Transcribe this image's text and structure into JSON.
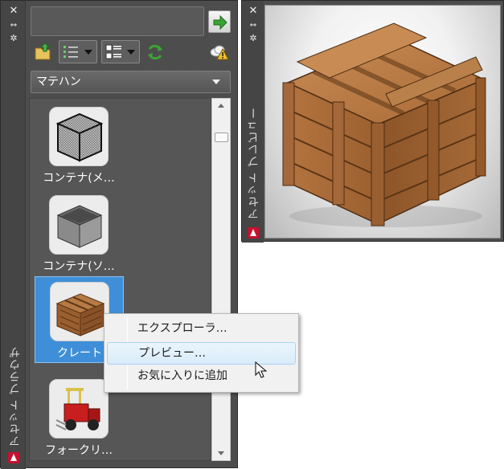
{
  "browser": {
    "title": "アセット ブラウザ",
    "search": {
      "value": "",
      "placeholder": ""
    },
    "category": {
      "selected": "マテハン"
    },
    "items": [
      {
        "label": "コンテナ(メ…",
        "icon": "wire-mesh-container-icon",
        "selected": false
      },
      {
        "label": "コンテナ(ソ…",
        "icon": "solid-container-icon",
        "selected": false
      },
      {
        "label": "クレート",
        "icon": "crate-icon",
        "selected": true
      },
      {
        "label": "フォークリ…",
        "icon": "forklift-icon",
        "selected": false
      }
    ]
  },
  "context_menu": {
    "items": [
      {
        "label": "エクスプローラ…"
      },
      {
        "label": "プレビュー…",
        "hovered": true
      },
      {
        "label": "お気に入りに追加"
      }
    ]
  },
  "preview": {
    "title": "アセット プレビュー",
    "subject_icon": "wooden-crate-icon"
  },
  "colors": {
    "panel_bg": "#4d4d4d",
    "selection": "#3f8fd8",
    "menu_hover": "#d9ecf9",
    "app_red": "#c8102e",
    "go_green": "#3aa335"
  }
}
